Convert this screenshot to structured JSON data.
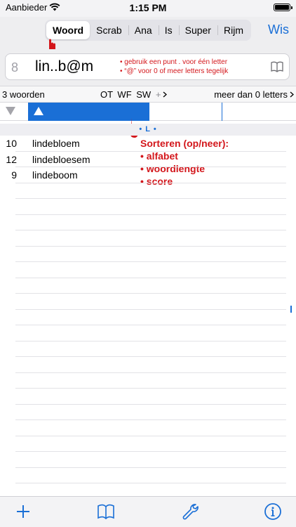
{
  "status": {
    "carrier": "Aanbieder",
    "time": "1:15 PM"
  },
  "tabs": [
    {
      "label": "Woord",
      "active": true
    },
    {
      "label": "Scrab",
      "active": false
    },
    {
      "label": "Ana",
      "active": false
    },
    {
      "label": "Is",
      "active": false
    },
    {
      "label": "Super",
      "active": false
    },
    {
      "label": "Rijm",
      "active": false
    }
  ],
  "clear_label": "Wis",
  "search": {
    "length": "8",
    "query": "lin..b@m",
    "hint1": "• gebruik een punt . voor één letter",
    "hint2": "• “@” voor 0 of meer letters tegelijk"
  },
  "info": {
    "count": "3 woorden",
    "codes": "OT WF SW",
    "plus": "+",
    "more": "meer dan 0 letters"
  },
  "letter_index": {
    "bullet1": "•",
    "letter": "L",
    "bullet2": "•"
  },
  "words": [
    {
      "score": "10",
      "word": "lindebloem"
    },
    {
      "score": "12",
      "word": "lindebloesem"
    },
    {
      "score": "9",
      "word": "lindeboom"
    }
  ],
  "annotation": {
    "title": "Sorteren (op/neer):",
    "items": [
      "• alfabet",
      "• woordlengte",
      "• score"
    ]
  },
  "colors": {
    "accent": "#1a6fd6",
    "annotation": "#d3161b"
  }
}
